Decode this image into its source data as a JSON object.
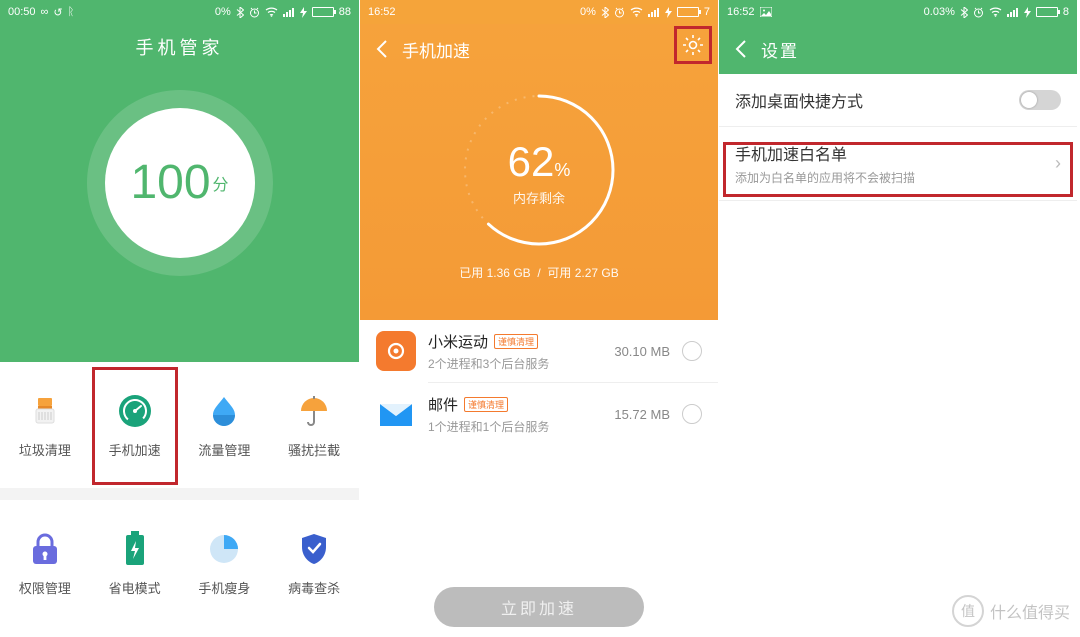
{
  "screen1": {
    "status": {
      "time": "00:50",
      "battery": "88",
      "pct": "0%"
    },
    "title": "手机管家",
    "score_num": "100",
    "score_suffix": "分",
    "grid": [
      {
        "label": "垃圾清理"
      },
      {
        "label": "手机加速"
      },
      {
        "label": "流量管理"
      },
      {
        "label": "骚扰拦截"
      },
      {
        "label": "权限管理"
      },
      {
        "label": "省电模式"
      },
      {
        "label": "手机瘦身"
      },
      {
        "label": "病毒查杀"
      }
    ]
  },
  "screen2": {
    "status": {
      "time": "16:52",
      "battery": "7",
      "pct": "0%"
    },
    "title": "手机加速",
    "gauge_value": "62",
    "gauge_pct": "%",
    "gauge_label": "内存剩余",
    "mem_used_lbl": "已用",
    "mem_used": "1.36 GB",
    "mem_sep": "/",
    "mem_avail_lbl": "可用",
    "mem_avail": "2.27 GB",
    "apps": [
      {
        "name": "小米运动",
        "tag": "谨慎清理",
        "sub": "2个进程和3个后台服务",
        "size": "30.10 MB"
      },
      {
        "name": "邮件",
        "tag": "谨慎清理",
        "sub": "1个进程和1个后台服务",
        "size": "15.72 MB"
      }
    ],
    "action": "立即加速"
  },
  "screen3": {
    "status": {
      "time": "16:52",
      "battery": "8",
      "pct": "0.03%"
    },
    "title": "设置",
    "row_shortcut": "添加桌面快捷方式",
    "row_whitelist": "手机加速白名单",
    "row_whitelist_sub": "添加为白名单的应用将不会被扫描"
  },
  "watermark": "什么值得买"
}
